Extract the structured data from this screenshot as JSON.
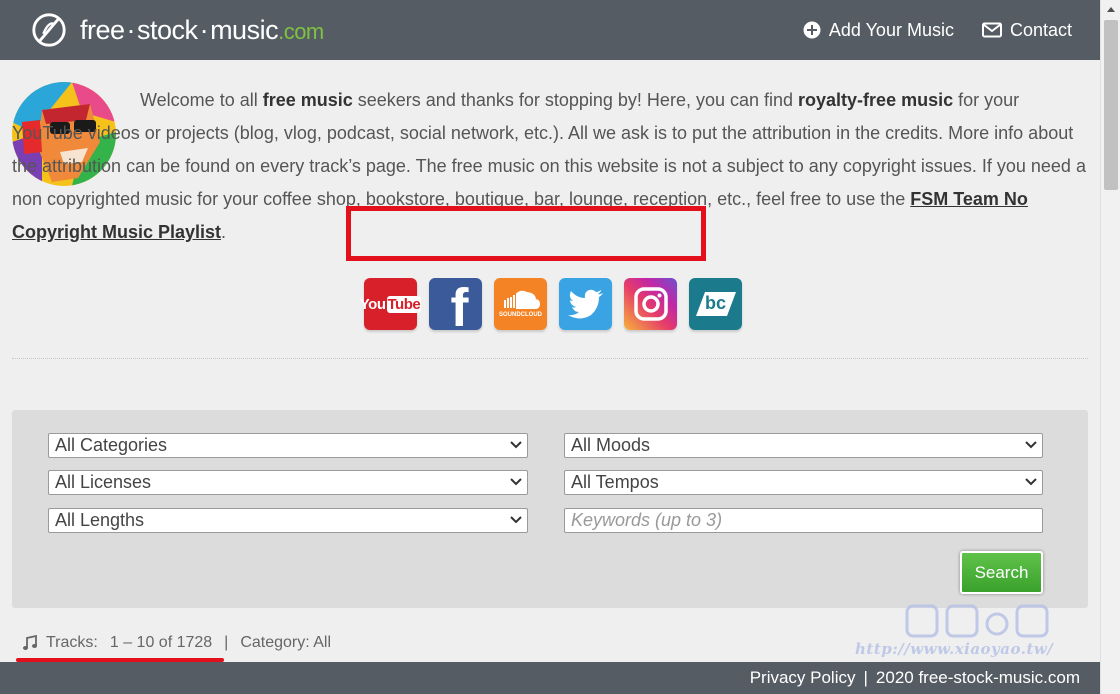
{
  "header": {
    "logo": {
      "part1": "free",
      "part2": "stock",
      "part3": "music",
      "tld": ".com",
      "dot": "·"
    },
    "nav": [
      {
        "label": "Add Your Music",
        "icon": "plus-circle-icon"
      },
      {
        "label": "Contact",
        "icon": "envelope-icon"
      }
    ]
  },
  "intro": {
    "s1": "Welcome to all ",
    "b1": "free music",
    "s2": " seekers and thanks for stopping by! Here, you can find ",
    "b2": "royalty-free music",
    "s3": " for your YouTube videos or projects (blog, vlog, podcast, social network, etc.). All we ask is to put the attribution in the credits. More info about the attribution can be found on every track’s page. The free music on this website is not a subject to any copyright issues. If you need a non copyrighted music for your coffee shop, bookstore, boutique, bar, lounge, reception, etc., feel free to use the ",
    "link": "FSM Team No Copyright Music Playlist",
    "end": "."
  },
  "socials": {
    "youtube": {
      "icon": "youtube-icon",
      "text_a": "You",
      "text_b": "Tube"
    },
    "facebook": {
      "icon": "facebook-icon",
      "text": "f"
    },
    "soundcloud": {
      "icon": "soundcloud-icon",
      "text": "SOUNDCLOUD"
    },
    "twitter": {
      "icon": "twitter-icon"
    },
    "instagram": {
      "icon": "instagram-icon"
    },
    "bandcamp": {
      "icon": "bandcamp-icon",
      "text": "bc"
    }
  },
  "filters": {
    "categories": "All Categories",
    "moods": "All Moods",
    "licenses": "All Licenses",
    "tempos": "All Tempos",
    "lengths": "All Lengths",
    "keywords_placeholder": "Keywords (up to 3)",
    "search": "Search"
  },
  "tracks": {
    "label": "Tracks:",
    "range": "1 – 10 of 1728",
    "sep": "|",
    "category": "Category: All"
  },
  "footer": {
    "privacy": "Privacy Policy",
    "sep": "|",
    "copyright": "2020  free-stock-music.com"
  },
  "watermark": {
    "url": "http://www.xiaoyao.tw/"
  },
  "colors": {
    "header_bg": "#555c63",
    "accent_green": "#7fc242",
    "highlight_red": "#e3101b",
    "search_green": "#4cb23a"
  }
}
